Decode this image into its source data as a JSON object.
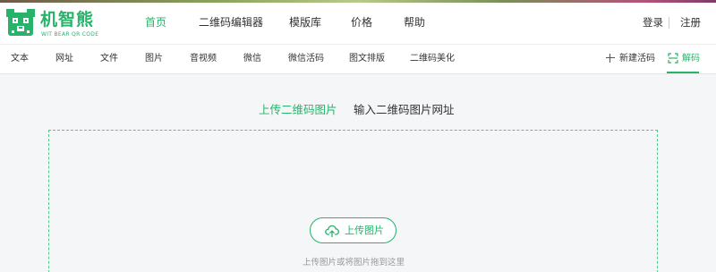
{
  "brand": {
    "name": "机智熊",
    "tagline": "WIT BEAR QR CODE",
    "accent_color": "#27b36a",
    "logo_icon": "bear-qr-icon"
  },
  "main_nav": {
    "items": [
      {
        "label": "首页",
        "active": true
      },
      {
        "label": "二维码编辑器",
        "active": false
      },
      {
        "label": "模版库",
        "active": false
      },
      {
        "label": "价格",
        "active": false
      },
      {
        "label": "帮助",
        "active": false
      }
    ]
  },
  "auth": {
    "login": "登录",
    "register": "注册"
  },
  "sub_nav": {
    "items": [
      {
        "label": "文本"
      },
      {
        "label": "网址"
      },
      {
        "label": "文件"
      },
      {
        "label": "图片"
      },
      {
        "label": "音视频"
      },
      {
        "label": "微信"
      },
      {
        "label": "微信活码"
      },
      {
        "label": "图文排版"
      },
      {
        "label": "二维码美化"
      }
    ],
    "new_code": {
      "label": "新建活码",
      "icon": "plus-icon"
    },
    "decode": {
      "label": "解码",
      "icon": "scan-icon",
      "active": true
    }
  },
  "upload": {
    "tabs": [
      {
        "label": "上传二维码图片",
        "active": true
      },
      {
        "label": "输入二维码图片网址",
        "active": false
      }
    ],
    "button_label": "上传图片",
    "button_icon": "cloud-upload-icon",
    "hint": "上传图片或将图片拖到这里"
  }
}
